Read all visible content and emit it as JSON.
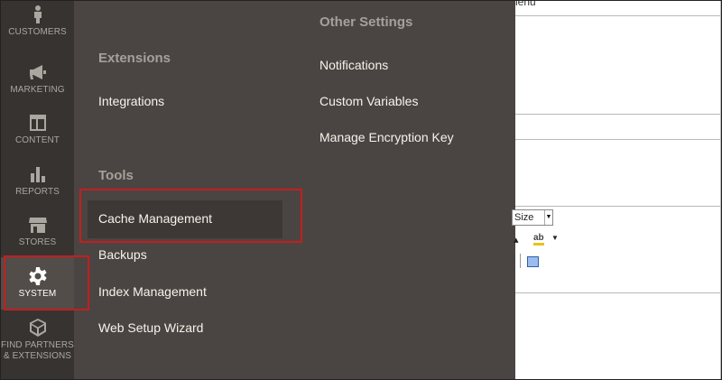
{
  "sidebar": {
    "items": [
      {
        "label": "CUSTOMERS",
        "icon": "customers-icon"
      },
      {
        "label": "MARKETING",
        "icon": "megaphone-icon"
      },
      {
        "label": "CONTENT",
        "icon": "content-layout-icon"
      },
      {
        "label": "REPORTS",
        "icon": "bar-chart-icon"
      },
      {
        "label": "STORES",
        "icon": "store-icon"
      },
      {
        "label": "SYSTEM",
        "icon": "gear-icon",
        "active": true
      },
      {
        "label_line1": "FIND PARTNERS",
        "label_line2": "& EXTENSIONS",
        "icon": "cube-icon"
      }
    ]
  },
  "flyout": {
    "extensions": {
      "title": "Extensions",
      "links": [
        "Integrations"
      ]
    },
    "tools": {
      "title": "Tools",
      "links": [
        "Cache Management",
        "Backups",
        "Index Management",
        "Web Setup Wizard"
      ],
      "active": "Cache Management"
    },
    "other_settings": {
      "title": "Other Settings",
      "links": [
        "Notifications",
        "Custom Variables",
        "Manage Encryption Key"
      ]
    }
  },
  "content": {
    "cut_text": "lenu",
    "font_size_select": "Size"
  },
  "colors": {
    "sidebar_bg": "#373330",
    "flyout_bg": "#4a4542",
    "highlight": "#c41e20"
  }
}
